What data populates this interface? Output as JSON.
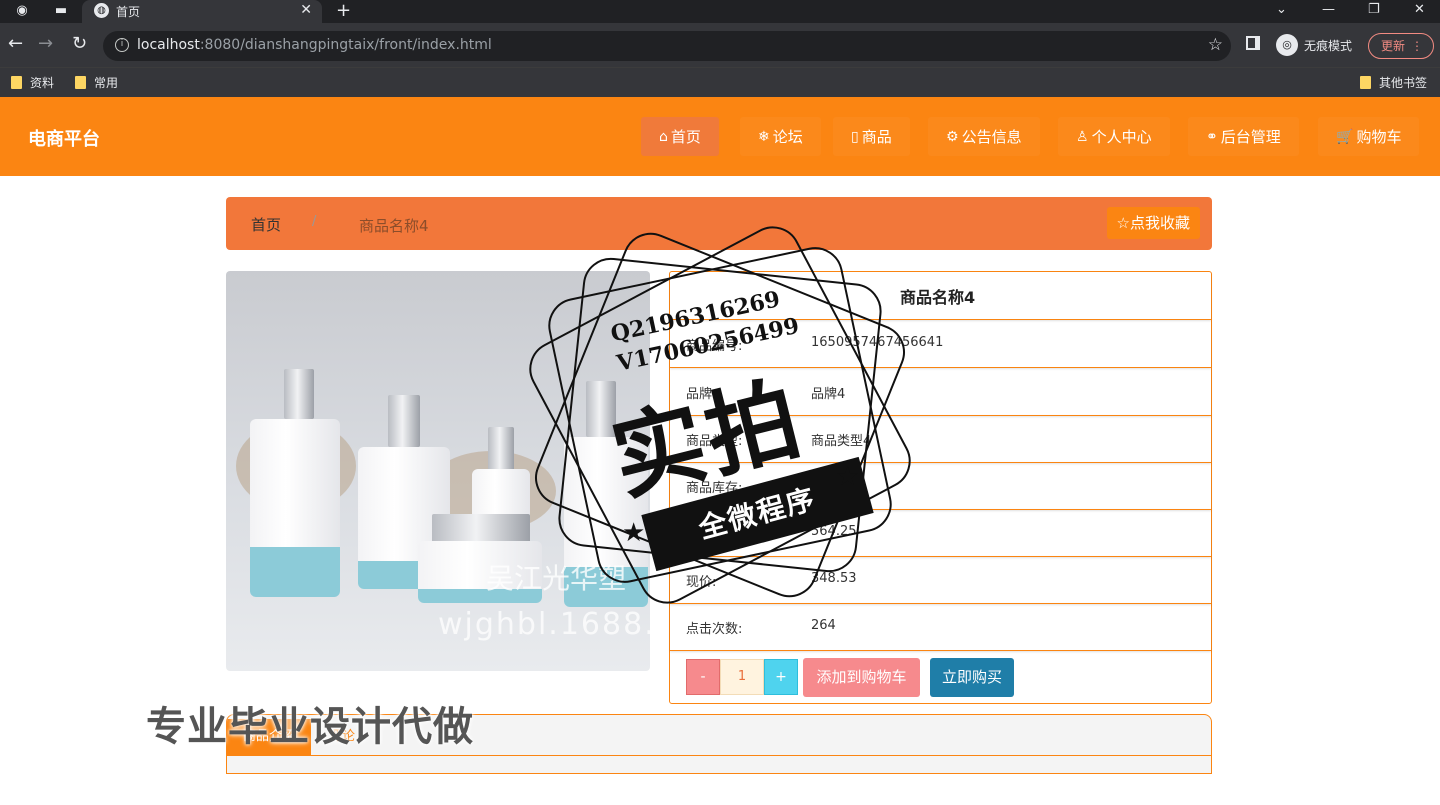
{
  "browser": {
    "tab_title": "首页",
    "url_host": "localhost",
    "url_rest": ":8080/dianshangpingtaix/front/index.html",
    "incognito_label": "无痕模式",
    "update_label": "更新",
    "bookmarks": [
      "资料",
      "常用"
    ],
    "other_bookmarks": "其他书签"
  },
  "site": {
    "brand": "电商平台",
    "menu": [
      {
        "icon": "⌂",
        "label": "首页"
      },
      {
        "icon": "❄",
        "label": "论坛"
      },
      {
        "icon": "▯",
        "label": "商品"
      },
      {
        "icon": "⚙",
        "label": "公告信息"
      },
      {
        "icon": "♙",
        "label": "个人中心"
      },
      {
        "icon": "⚭",
        "label": "后台管理"
      },
      {
        "icon": "🛒",
        "label": "购物车"
      }
    ]
  },
  "breadcrumb": {
    "home": "首页",
    "separator": "/",
    "current": "商品名称4",
    "collect_icon": "☆",
    "collect_label": "点我收藏"
  },
  "image": {
    "watermark_line1": "吴江光华塑",
    "watermark_line2": "wjghbl.1688.c"
  },
  "product": {
    "title": "商品名称4",
    "rows": [
      {
        "label": "商品编号:",
        "value": "1650957467456641"
      },
      {
        "label": "品牌:",
        "value": "品牌4"
      },
      {
        "label": "商品类型:",
        "value": "商品类型4"
      },
      {
        "label": "商品库存:",
        "value": "4"
      },
      {
        "label": "原价:",
        "value": "564.25"
      },
      {
        "label": "现价:",
        "value": "348.53"
      },
      {
        "label": "点击次数:",
        "value": "264"
      }
    ],
    "qty_minus": "-",
    "qty_value": "1",
    "qty_plus": "+",
    "add_cart": "添加到购物车",
    "buy_now": "立即购买"
  },
  "bottom_tabs": {
    "active": "商品介绍",
    "other": "评论"
  },
  "stamp": {
    "q_line": "Q2196316269",
    "v_line": "V17060256499",
    "big": "实拍",
    "ribbon": "全微程序"
  },
  "overlay_text": "专业毕业设计代做"
}
